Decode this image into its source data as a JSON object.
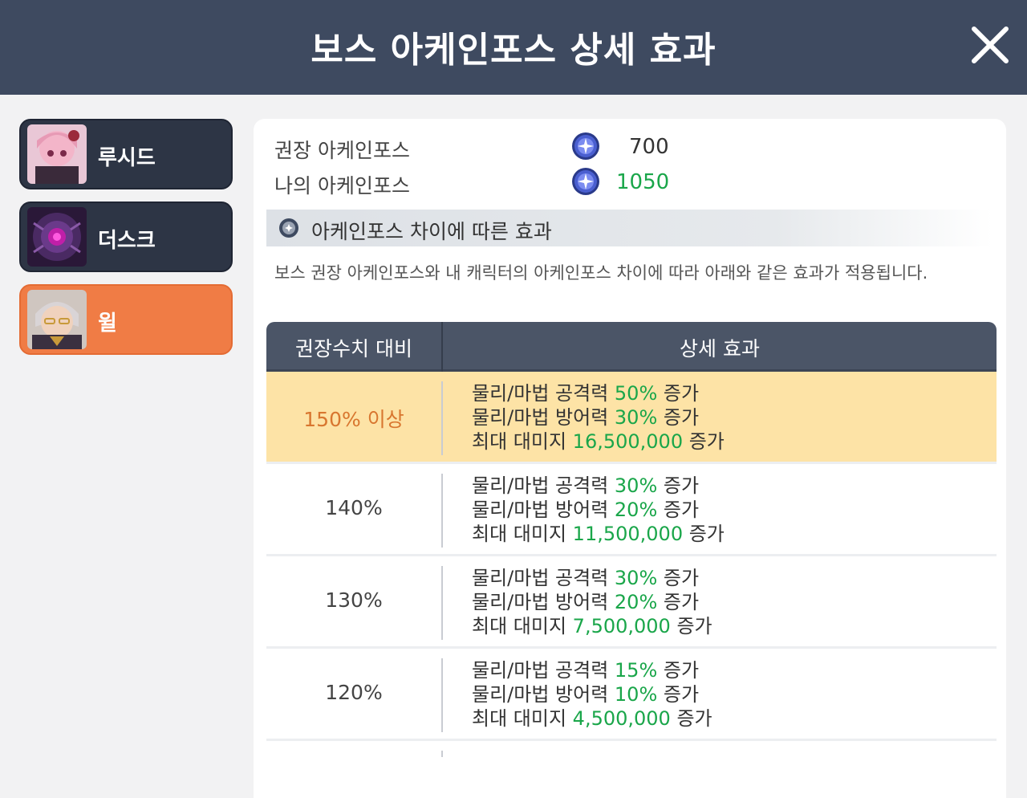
{
  "header": {
    "title": "보스 아케인포스 상세 효과"
  },
  "sidebar": {
    "items": [
      {
        "name": "루시드",
        "active": false
      },
      {
        "name": "더스크",
        "active": false
      },
      {
        "name": "윌",
        "active": true
      }
    ]
  },
  "force": {
    "recommended_label": "권장 아케인포스",
    "recommended_value": "700",
    "mine_label": "나의 아케인포스",
    "mine_value": "1050"
  },
  "section": {
    "title": "아케인포스 차이에 따른 효과",
    "description": "보스 권장 아케인포스와 내 캐릭터의 아케인포스 차이에 따라 아래와 같은 효과가 적용됩니다."
  },
  "table": {
    "col1": "권장수치 대비",
    "col2": "상세 효과",
    "rows": [
      {
        "ratio": "150% 이상",
        "lines": [
          {
            "prefix": "물리/마법 공격력 ",
            "value": "50%",
            "suffix": " 증가"
          },
          {
            "prefix": "물리/마법 방어력 ",
            "value": "30%",
            "suffix": " 증가"
          },
          {
            "prefix": "최대 대미지 ",
            "value": "16,500,000",
            "suffix": " 증가"
          }
        ]
      },
      {
        "ratio": "140%",
        "lines": [
          {
            "prefix": "물리/마법 공격력 ",
            "value": "30%",
            "suffix": " 증가"
          },
          {
            "prefix": "물리/마법 방어력 ",
            "value": "20%",
            "suffix": " 증가"
          },
          {
            "prefix": "최대 대미지 ",
            "value": "11,500,000",
            "suffix": " 증가"
          }
        ]
      },
      {
        "ratio": "130%",
        "lines": [
          {
            "prefix": "물리/마법 공격력 ",
            "value": "30%",
            "suffix": " 증가"
          },
          {
            "prefix": "물리/마법 방어력 ",
            "value": "20%",
            "suffix": " 증가"
          },
          {
            "prefix": "최대 대미지 ",
            "value": "7,500,000",
            "suffix": " 증가"
          }
        ]
      },
      {
        "ratio": "120%",
        "lines": [
          {
            "prefix": "물리/마법 공격력 ",
            "value": "15%",
            "suffix": " 증가"
          },
          {
            "prefix": "물리/마법 방어력 ",
            "value": "10%",
            "suffix": " 증가"
          },
          {
            "prefix": "최대 대미지 ",
            "value": "4,500,000",
            "suffix": " 증가"
          }
        ]
      }
    ]
  },
  "colors": {
    "header": "#3e4a60",
    "active": "#f07c45",
    "green": "#1aa64a",
    "highlight": "#fde3a6"
  },
  "icons": {
    "close": "close-icon",
    "arcane": "arcane-force-icon",
    "section": "plus-circle-icon"
  }
}
